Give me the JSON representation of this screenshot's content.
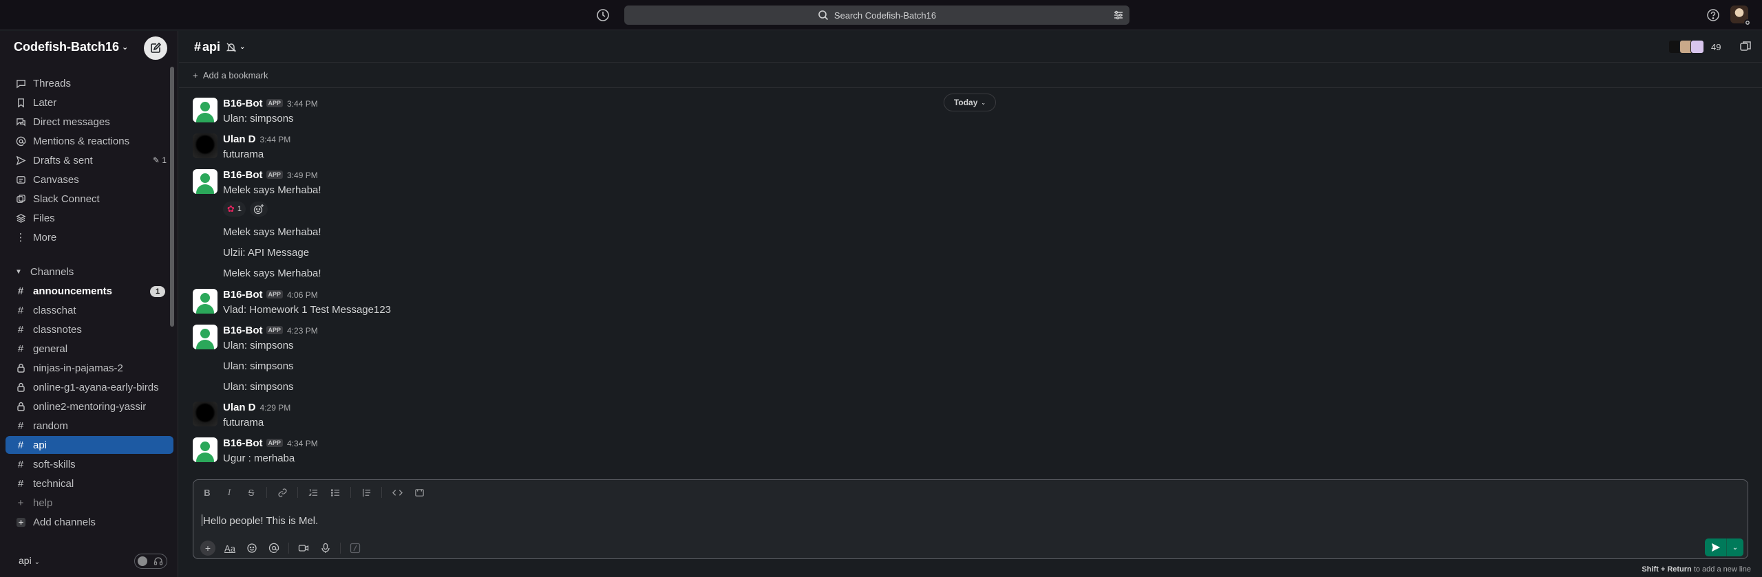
{
  "topbar": {
    "search_label": "Search Codefish-Batch16",
    "history_icon": "clock-icon",
    "help_icon": "help-icon"
  },
  "workspace": {
    "name": "Codefish-Batch16"
  },
  "sidebar": {
    "nav": [
      {
        "label": "Threads",
        "icon": "threads-icon"
      },
      {
        "label": "Later",
        "icon": "bookmark-icon"
      },
      {
        "label": "Direct messages",
        "icon": "dm-icon"
      },
      {
        "label": "Mentions & reactions",
        "icon": "at-icon"
      },
      {
        "label": "Drafts & sent",
        "icon": "send-icon",
        "count": "1"
      },
      {
        "label": "Canvases",
        "icon": "canvas-icon"
      },
      {
        "label": "Slack Connect",
        "icon": "connect-icon"
      },
      {
        "label": "Files",
        "icon": "files-icon"
      },
      {
        "label": "More",
        "icon": "more-icon"
      }
    ],
    "channels_section": "Channels",
    "channels": [
      {
        "name": "announcements",
        "type": "public",
        "unread": true,
        "badge": "1"
      },
      {
        "name": "classchat",
        "type": "public"
      },
      {
        "name": "classnotes",
        "type": "public"
      },
      {
        "name": "general",
        "type": "public"
      },
      {
        "name": "ninjas-in-pajamas-2",
        "type": "private"
      },
      {
        "name": "online-g1-ayana-early-birds",
        "type": "private"
      },
      {
        "name": "online2-mentoring-yassir",
        "type": "private"
      },
      {
        "name": "random",
        "type": "public"
      },
      {
        "name": "api",
        "type": "public",
        "active": true
      },
      {
        "name": "soft-skills",
        "type": "public"
      },
      {
        "name": "technical",
        "type": "public"
      },
      {
        "name": "help",
        "type": "add"
      }
    ],
    "add_channels": "Add channels",
    "footer_channel": "api"
  },
  "channel": {
    "name": "api",
    "member_count": "49",
    "add_bookmark": "Add a bookmark",
    "date_divider": "Today"
  },
  "messages": [
    {
      "author": "B16-Bot",
      "app": "APP",
      "time": "3:44 PM",
      "text": "Ulan: simpsons",
      "bot": true
    },
    {
      "author": "Ulan D",
      "time": "3:44 PM",
      "text": "futurama",
      "bot": false
    },
    {
      "author": "B16-Bot",
      "app": "APP",
      "time": "3:49 PM",
      "text": "Melek says Merhaba!",
      "bot": true
    },
    {
      "author": "B16-Bot",
      "app": "APP",
      "time": "4:06 PM",
      "text": "Vlad: Homework 1 Test Message123",
      "bot": true
    },
    {
      "author": "B16-Bot",
      "app": "APP",
      "time": "4:23 PM",
      "text": "Ulan: simpsons",
      "bot": true
    },
    {
      "author": "Ulan D",
      "time": "4:29 PM",
      "text": "futurama",
      "bot": false
    },
    {
      "author": "B16-Bot",
      "app": "APP",
      "time": "4:34 PM",
      "text": "Ugur : merhaba",
      "bot": true
    }
  ],
  "continuations": {
    "c1": "Melek says Merhaba!",
    "c2": "Ulzii: API Message",
    "c3": "Melek says Merhaba!",
    "c4": "Ulan: simpsons",
    "c5": "Ulan: simpsons"
  },
  "reaction": {
    "emoji": "✿",
    "count": "1"
  },
  "composer": {
    "text": "Hello people! This is Mel.",
    "hint_keys": "Shift + Return",
    "hint_text": " to add a new line"
  }
}
